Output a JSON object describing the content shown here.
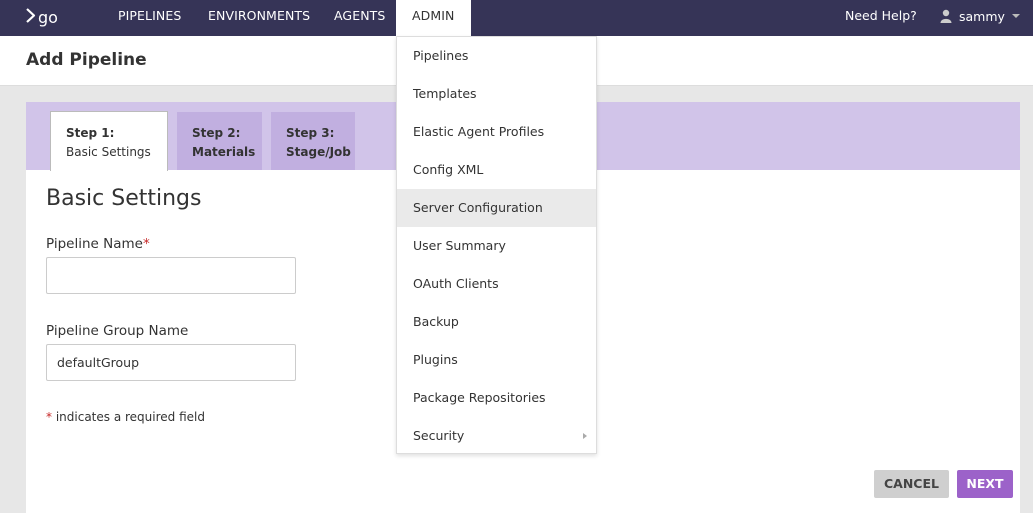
{
  "nav": {
    "logo": "go",
    "items": [
      "PIPELINES",
      "ENVIRONMENTS",
      "AGENTS",
      "ADMIN"
    ],
    "active": "ADMIN",
    "help": "Need Help?",
    "user": "sammy"
  },
  "header": {
    "title": "Add Pipeline"
  },
  "tabs": [
    {
      "step": "Step 1:",
      "label": "Basic Settings",
      "active": true
    },
    {
      "step": "Step 2:",
      "label": "Materials",
      "active": false
    },
    {
      "step": "Step 3:",
      "label": "Stage/Job",
      "active": false
    }
  ],
  "form": {
    "section_title": "Basic Settings",
    "pipeline_name_label": "Pipeline Name",
    "required_mark": "*",
    "pipeline_name_value": "",
    "group_name_label": "Pipeline Group Name",
    "group_name_value": "defaultGroup",
    "required_note": "indicates a required field"
  },
  "buttons": {
    "cancel": "CANCEL",
    "next": "NEXT"
  },
  "admin_menu": {
    "items": [
      "Pipelines",
      "Templates",
      "Elastic Agent Profiles",
      "Config XML",
      "Server Configuration",
      "User Summary",
      "OAuth Clients",
      "Backup",
      "Plugins",
      "Package Repositories",
      "Security"
    ],
    "hovered": "Server Configuration",
    "submenu_item": "Security"
  },
  "colors": {
    "nav_bg": "#363457",
    "tab_bar": "#d1c4e9",
    "tab_inactive": "#c1afe0",
    "primary_button": "#9c62c9",
    "required": "#c62828"
  }
}
